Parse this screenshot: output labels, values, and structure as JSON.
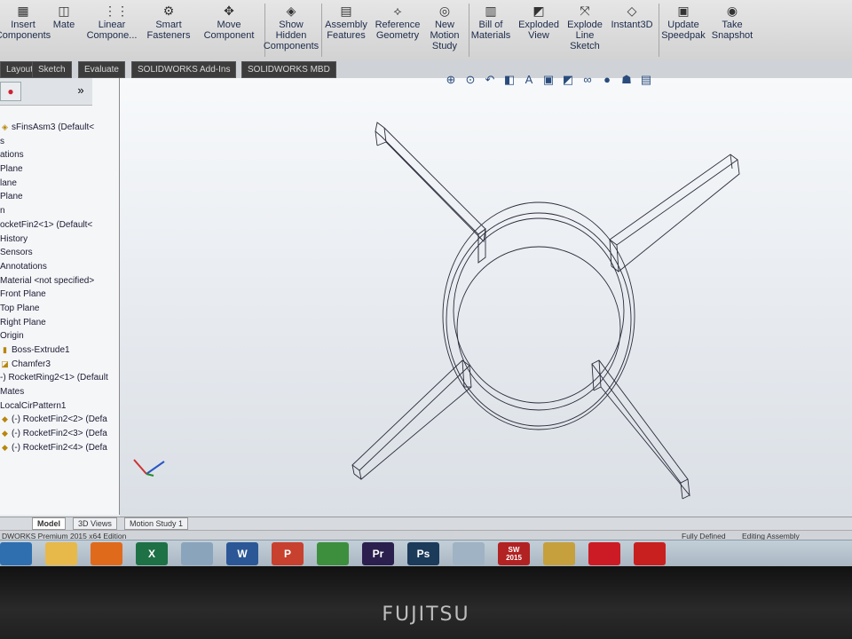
{
  "ribbon": {
    "buttons": [
      {
        "label": "Insert\nComponents",
        "icon": "insert-components-icon"
      },
      {
        "label": "Mate",
        "icon": "mate-icon"
      },
      {
        "label": "Linear\nCompone...",
        "icon": "linear-pattern-icon"
      },
      {
        "label": "Smart\nFasteners",
        "icon": "smart-fasteners-icon"
      },
      {
        "label": "Move\nComponent",
        "icon": "move-component-icon"
      },
      {
        "label": "Show\nHidden\nComponents",
        "icon": "show-hidden-icon"
      },
      {
        "label": "Assembly\nFeatures",
        "icon": "assembly-features-icon"
      },
      {
        "label": "Reference\nGeometry",
        "icon": "reference-geometry-icon"
      },
      {
        "label": "New\nMotion\nStudy",
        "icon": "motion-study-icon"
      },
      {
        "label": "Bill of\nMaterials",
        "icon": "bom-icon"
      },
      {
        "label": "Exploded\nView",
        "icon": "exploded-view-icon"
      },
      {
        "label": "Explode\nLine\nSketch",
        "icon": "explode-line-icon"
      },
      {
        "label": "Instant3D",
        "icon": "instant3d-icon"
      },
      {
        "label": "Update\nSpeedpak",
        "icon": "speedpak-icon"
      },
      {
        "label": "Take\nSnapshot",
        "icon": "snapshot-icon"
      }
    ],
    "tabs": [
      "Layout",
      "Sketch",
      "Evaluate",
      "SOLIDWORKS Add-Ins",
      "SOLIDWORKS MBD"
    ]
  },
  "feature_tree": {
    "items": [
      {
        "text": "sFinsAsm3  (Default<",
        "icon": "assembly-icon"
      },
      {
        "text": "s",
        "icon": ""
      },
      {
        "text": "ations",
        "icon": ""
      },
      {
        "text": "Plane",
        "icon": ""
      },
      {
        "text": "lane",
        "icon": ""
      },
      {
        "text": " Plane",
        "icon": ""
      },
      {
        "text": "n",
        "icon": ""
      },
      {
        "text": "ocketFin2<1> (Default<",
        "icon": ""
      },
      {
        "text": "History",
        "icon": ""
      },
      {
        "text": "Sensors",
        "icon": ""
      },
      {
        "text": "Annotations",
        "icon": ""
      },
      {
        "text": "Material <not specified>",
        "icon": ""
      },
      {
        "text": "Front Plane",
        "icon": ""
      },
      {
        "text": "Top Plane",
        "icon": ""
      },
      {
        "text": "Right Plane",
        "icon": ""
      },
      {
        "text": "Origin",
        "icon": ""
      },
      {
        "text": "Boss-Extrude1",
        "icon": "extrude-icon"
      },
      {
        "text": "Chamfer3",
        "icon": "chamfer-icon"
      },
      {
        "text": "-) RocketRing2<1> (Default",
        "icon": ""
      },
      {
        "text": "Mates",
        "icon": ""
      },
      {
        "text": "LocalCirPattern1",
        "icon": ""
      },
      {
        "text": "(-) RocketFin2<2> (Defa",
        "icon": "part-icon"
      },
      {
        "text": "(-) RocketFin2<3> (Defa",
        "icon": "part-icon"
      },
      {
        "text": "(-) RocketFin2<4> (Defa",
        "icon": "part-icon"
      }
    ]
  },
  "bottom_tabs": [
    "Model",
    "3D Views",
    "Motion Study 1"
  ],
  "status": {
    "edition": "DWORKS Premium 2015 x64 Edition",
    "state": "Fully Defined",
    "mode": "Editing Assembly"
  },
  "taskbar": {
    "apps": [
      {
        "label": "",
        "icon": "windows-start-icon",
        "color": "#2f6fb0"
      },
      {
        "label": "",
        "icon": "folder-icon",
        "color": "#e7b84a"
      },
      {
        "label": "",
        "icon": "firefox-icon",
        "color": "#e06a1c"
      },
      {
        "label": "X",
        "icon": "excel-icon",
        "color": "#1e7145"
      },
      {
        "label": "",
        "icon": "document-icon",
        "color": "#8aa4bc"
      },
      {
        "label": "W",
        "icon": "word-icon",
        "color": "#2b5797"
      },
      {
        "label": "P",
        "icon": "powerpoint-icon",
        "color": "#c8402e"
      },
      {
        "label": "",
        "icon": "chrome-icon",
        "color": "#3d8f3d"
      },
      {
        "label": "Pr",
        "icon": "premiere-icon",
        "color": "#2b1f4d"
      },
      {
        "label": "Ps",
        "icon": "photoshop-icon",
        "color": "#1c3a5a"
      },
      {
        "label": "",
        "icon": "feather-icon",
        "color": "#9fb3c4"
      },
      {
        "label": "SW\n2015",
        "icon": "solidworks-icon",
        "color": "#b22222"
      },
      {
        "label": "",
        "icon": "puzzle-icon",
        "color": "#c6a03d"
      },
      {
        "label": "",
        "icon": "opera-icon",
        "color": "#cc1b24"
      },
      {
        "label": "",
        "icon": "acrobat-icon",
        "color": "#c8201e"
      }
    ]
  },
  "bezel": {
    "brand": "FUJITSU"
  }
}
